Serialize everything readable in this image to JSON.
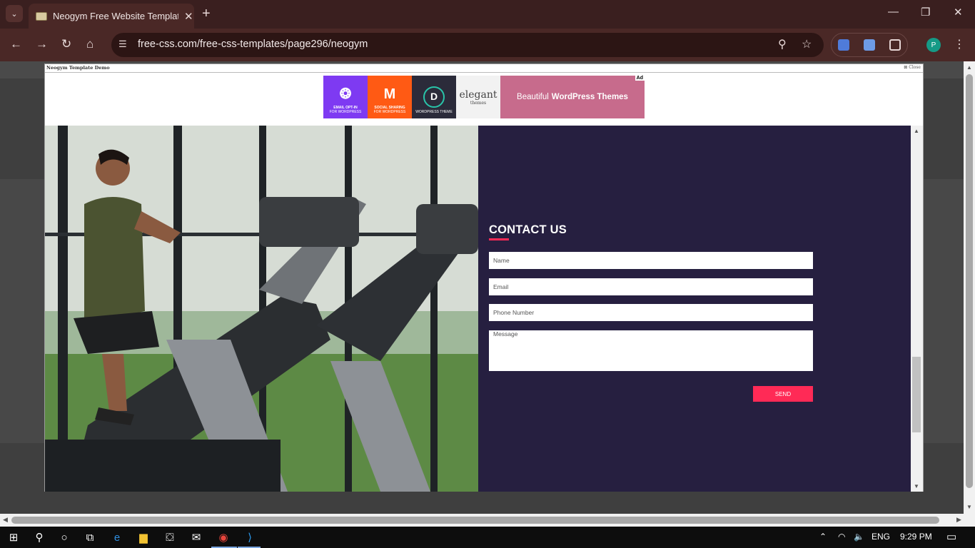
{
  "browser": {
    "tab_title": "Neogym Free Website Template",
    "url": "free-css.com/free-css-templates/page296/neogym",
    "profile_initial": "P"
  },
  "demo_bar": {
    "title": "Neogym Template Demo",
    "close_label": "Close"
  },
  "ad": {
    "tiles": [
      {
        "title": "EMAIL OPT-IN",
        "sub": "FOR WORDPRESS",
        "color": "#7e3af2",
        "icon": "bloom-icon"
      },
      {
        "title": "SOCIAL SHARING",
        "sub": "FOR WORDPRESS",
        "color": "#ff5a14",
        "icon": "monarch-icon"
      },
      {
        "title": "WORDPRESS THEME",
        "sub": "",
        "color": "#2b2b3a",
        "icon": "divi-icon"
      }
    ],
    "brand": "elegant",
    "brand_sub": "themes",
    "text_plain": "Beautiful",
    "text_bold": "WordPress Themes",
    "badge": "Ad"
  },
  "contact": {
    "title": "CONTACT US",
    "name_placeholder": "Name",
    "email_placeholder": "Email",
    "phone_placeholder": "Phone Number",
    "message_placeholder": "Message",
    "send_label": "SEND"
  },
  "taskbar": {
    "language": "ENG",
    "time": "9:29 PM"
  },
  "colors": {
    "contact_bg": "#261f40",
    "accent": "#ff2a56",
    "chrome_bg": "#4a2826"
  }
}
